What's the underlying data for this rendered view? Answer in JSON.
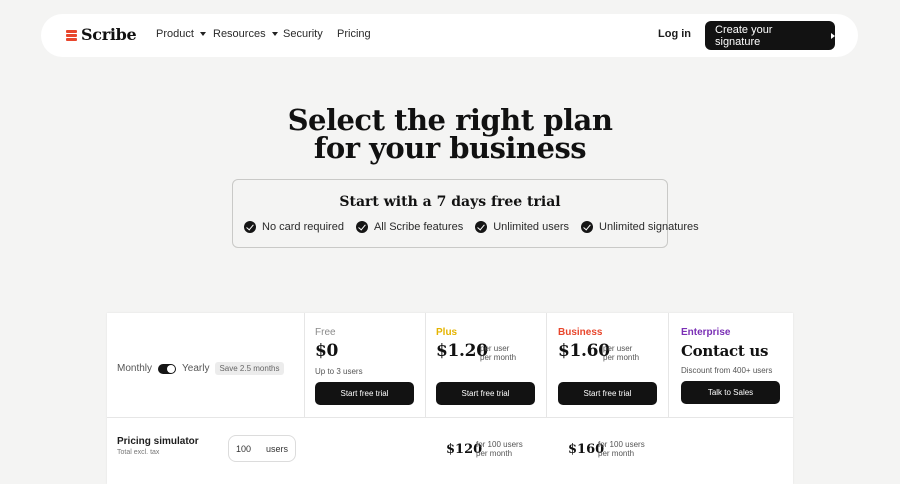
{
  "nav": {
    "brand": "Scribe",
    "items": [
      {
        "label": "Product",
        "has_caret": true
      },
      {
        "label": "Resources",
        "has_caret": true
      },
      {
        "label": "Security",
        "has_caret": false
      },
      {
        "label": "Pricing",
        "has_caret": false
      }
    ],
    "login": "Log in",
    "cta": "Create your signature"
  },
  "hero": {
    "line1": "Select the right plan",
    "line2": "for your business"
  },
  "trial": {
    "title": "Start with a 7 days free trial",
    "features": [
      "No card required",
      "All Scribe features",
      "Unlimited users",
      "Unlimited signatures"
    ]
  },
  "billing": {
    "monthly": "Monthly",
    "yearly": "Yearly",
    "save": "Save 2.5 months",
    "toggle_on": true
  },
  "plans": [
    {
      "name": "Free",
      "price": "$0",
      "per_1": "",
      "per_2": "",
      "note": "Up to 3 users",
      "button": "Start free trial",
      "color": "#8a8a8a"
    },
    {
      "name": "Plus",
      "price": "$1.20",
      "per_1": "per user",
      "per_2": "per month",
      "note": "",
      "button": "Start free trial",
      "color": "#e5b400"
    },
    {
      "name": "Business",
      "price": "$1.60",
      "per_1": "per user",
      "per_2": "per month",
      "note": "",
      "button": "Start free trial",
      "color": "#e8462c"
    },
    {
      "name": "Enterprise",
      "price": "Contact us",
      "per_1": "",
      "per_2": "",
      "note": "Discount from 400+ users",
      "button": "Talk to Sales",
      "color": "#7a2fb5"
    }
  ],
  "simulator": {
    "title": "Pricing simulator",
    "subtitle": "Total excl. tax",
    "users_value": "100",
    "users_label": "users",
    "plus": {
      "price": "$120",
      "per_1": "for 100 users",
      "per_2": "per month"
    },
    "business": {
      "price": "$160",
      "per_1": "for 100 users",
      "per_2": "per month"
    }
  },
  "colors": {
    "brand": "#e8462c",
    "dark": "#121212",
    "background": "#f4f4f3"
  }
}
